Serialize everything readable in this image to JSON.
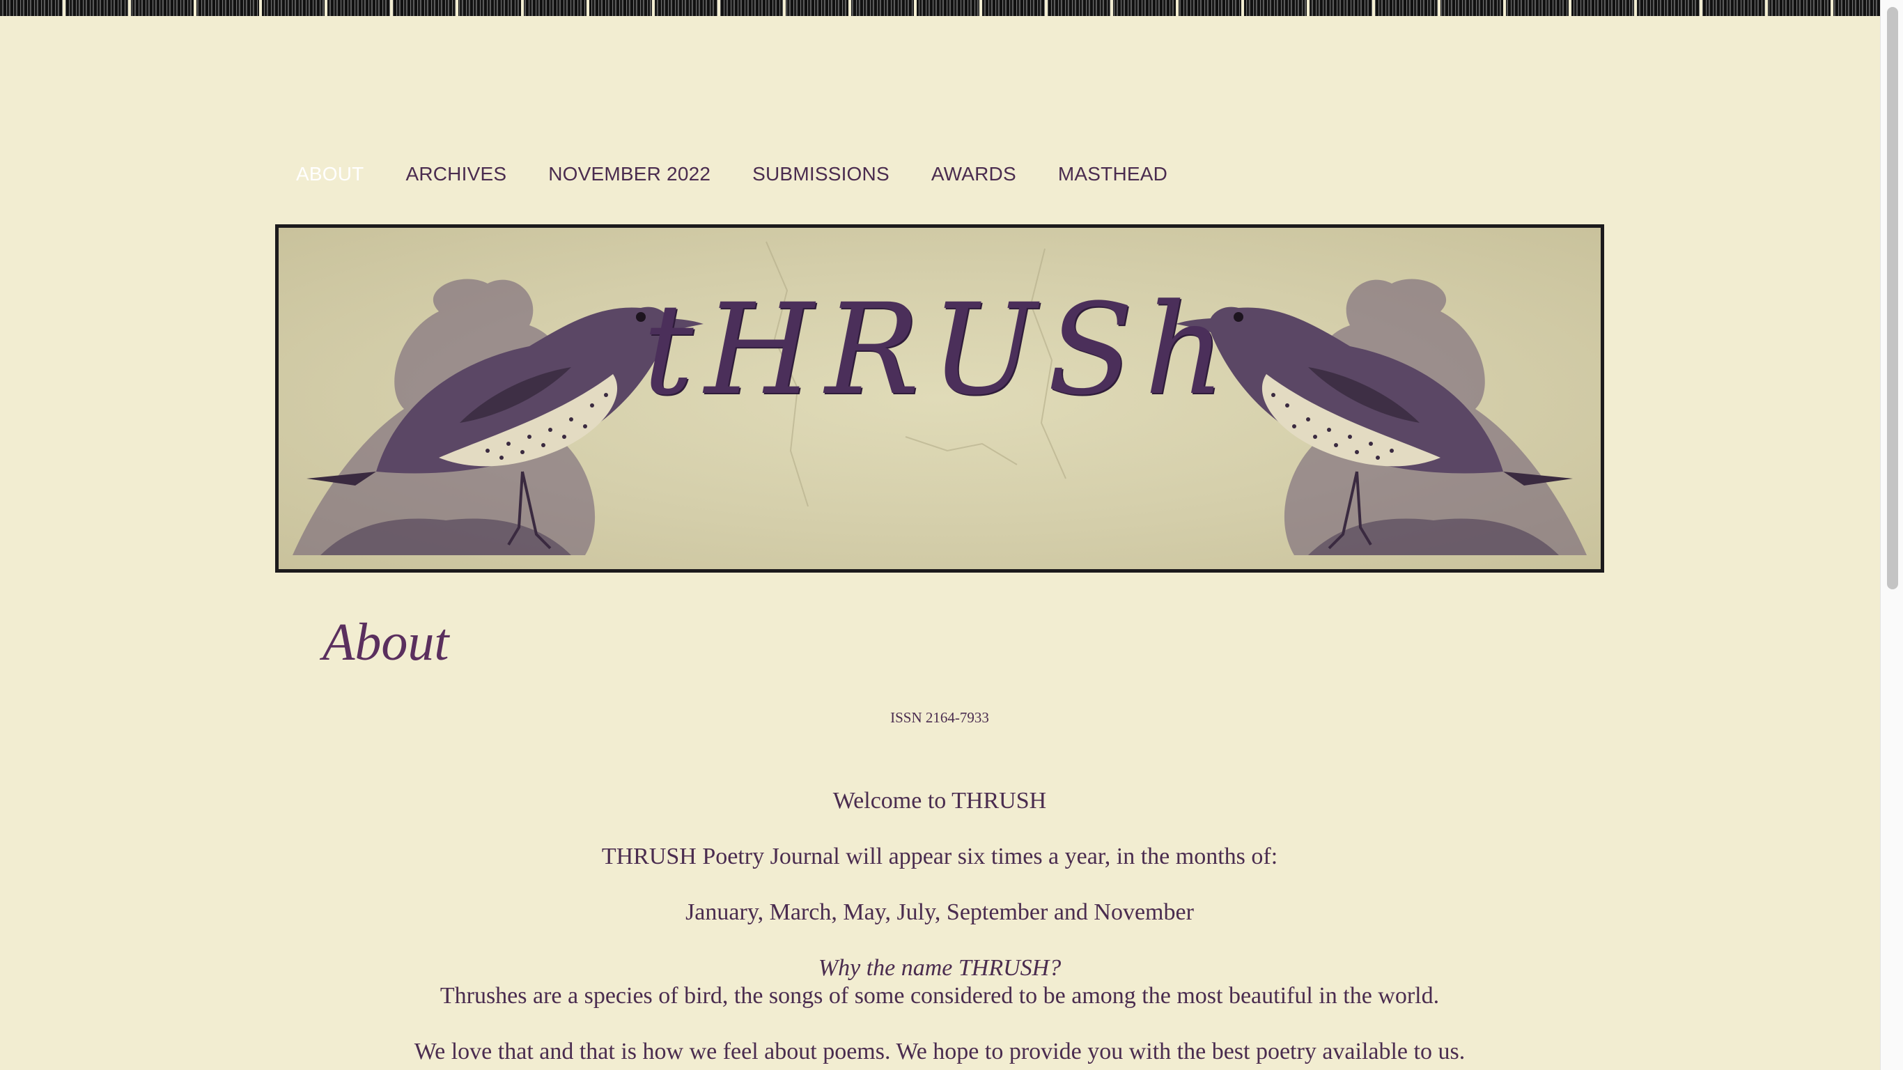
{
  "nav": {
    "items": [
      {
        "label": "ABOUT",
        "active": true
      },
      {
        "label": "ARCHIVES",
        "active": false
      },
      {
        "label": "NOVEMBER 2022",
        "active": false
      },
      {
        "label": "SUBMISSIONS",
        "active": false
      },
      {
        "label": "AWARDS",
        "active": false
      },
      {
        "label": "MASTHEAD",
        "active": false
      }
    ]
  },
  "banner": {
    "title": "tHRUSh"
  },
  "page": {
    "title": "About",
    "issn": "ISSN 2164-7933",
    "welcome": "Welcome to THRUSH",
    "schedule": "THRUSH Poetry Journal will appear six times a year, in the months of:",
    "months": "January, March, May, July, September and November",
    "why_heading": "Why the name THRUSH?",
    "why_text": "Thrushes are a species of bird, the songs of some considered to be among the most beautiful in the world.",
    "love_text": "We love that and that is how we feel about poems. We hope to provide you with the best poetry available to us."
  },
  "colors": {
    "background": "#f2edd1",
    "text": "#4a2c4f",
    "title": "#5a2f5e",
    "nav_active": "#ffffff"
  }
}
